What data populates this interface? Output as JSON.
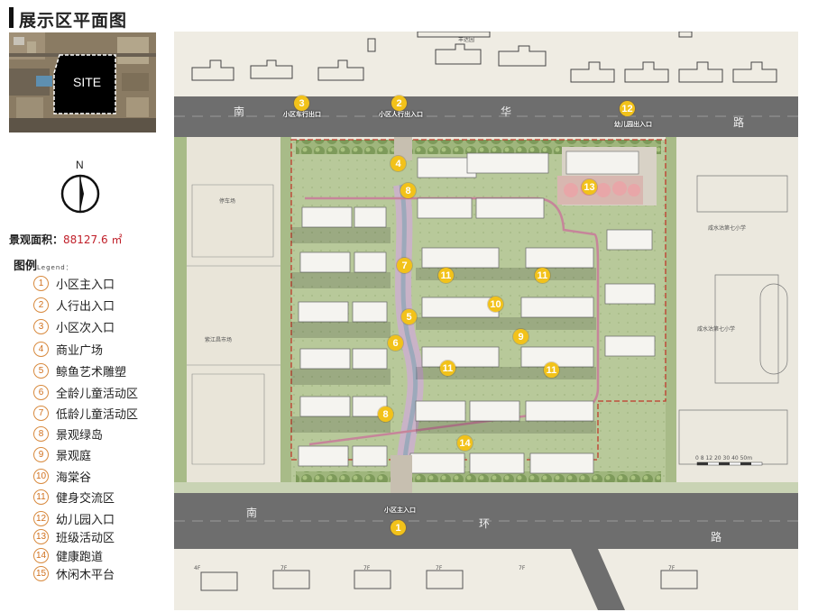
{
  "page": {
    "title": "展示区平面图"
  },
  "thumbnail": {
    "site_label": "SITE"
  },
  "compass": {
    "label": "N"
  },
  "area": {
    "label": "景观面积：",
    "value": "88127.6 ㎡"
  },
  "legend": {
    "title": "图例",
    "subtitle": "Legend：",
    "items": [
      {
        "num": "1",
        "label": "小区主入口"
      },
      {
        "num": "2",
        "label": "人行出入口"
      },
      {
        "num": "3",
        "label": "小区次入口"
      },
      {
        "num": "4",
        "label": "商业广场"
      },
      {
        "num": "5",
        "label": "鲸鱼艺术雕塑"
      },
      {
        "num": "6",
        "label": "全龄儿童活动区"
      },
      {
        "num": "7",
        "label": "低龄儿童活动区"
      },
      {
        "num": "8",
        "label": "景观绿岛"
      },
      {
        "num": "9",
        "label": "景观庭"
      },
      {
        "num": "10",
        "label": "海棠谷"
      },
      {
        "num": "11",
        "label": "健身交流区"
      },
      {
        "num": "12",
        "label": "幼儿园入口"
      },
      {
        "num": "13",
        "label": "班级活动区"
      },
      {
        "num": "14",
        "label": "健康跑道"
      },
      {
        "num": "15",
        "label": "休闲木平台"
      }
    ]
  },
  "plan": {
    "north_road": [
      "南",
      "华",
      "路"
    ],
    "south_road": [
      "南",
      "环",
      "路"
    ],
    "gate_labels": {
      "vehicle_exit": "小区车行出口",
      "pedestrian": "小区人行出入口",
      "kindergarten": "幼儿园出入口",
      "main": "小区主入口"
    },
    "markers": [
      "1",
      "2",
      "3",
      "4",
      "5",
      "6",
      "7",
      "8",
      "8",
      "9",
      "10",
      "11",
      "11",
      "11",
      "11",
      "12",
      "13",
      "14"
    ],
    "labels": {
      "top_street": "丰达园",
      "parking": "停车场",
      "market": "紫江昌市场",
      "school_1": "咸水沽第七小学",
      "school_2": "咸水沽第七小学",
      "scale": "0 8 12 20 30 40 50m",
      "floor_marks": [
        "4F",
        "7F",
        "7F",
        "7F",
        "7F",
        "7F"
      ]
    },
    "colors": {
      "road": "#6f6f6f",
      "badge": "#f2c21a",
      "boundary": "#c0392b",
      "accent": "#c0202a"
    }
  }
}
